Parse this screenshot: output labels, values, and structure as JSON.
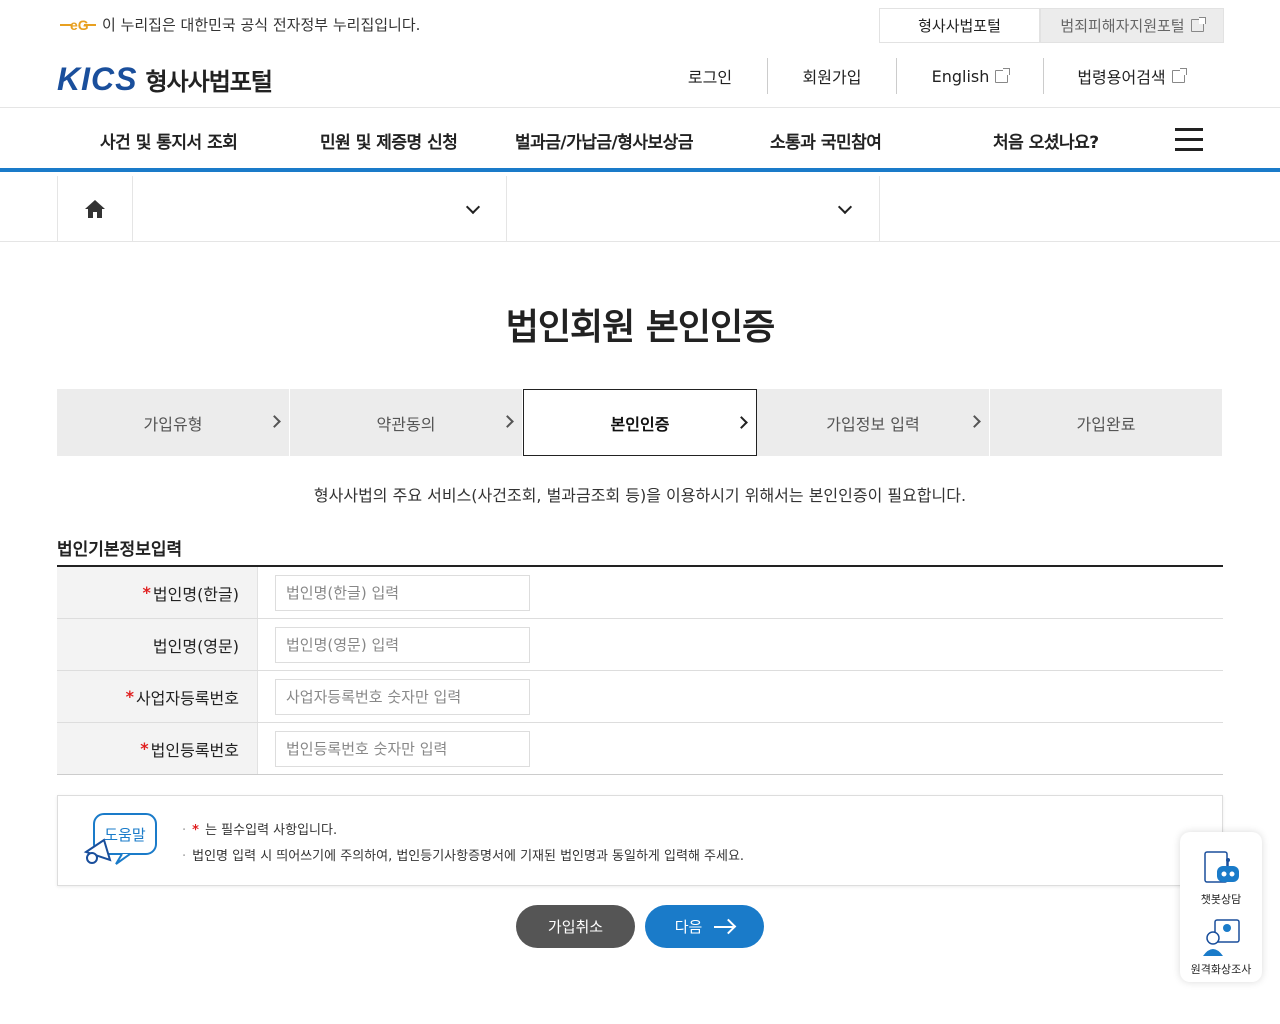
{
  "topbar": {
    "gov_notice": "이 누리집은 대한민국 공식 전자정부 누리집입니다.",
    "portals": [
      "형사사법포털",
      "범죄피해자지원포털"
    ]
  },
  "header": {
    "logo_brand": "KICS",
    "logo_name": "형사사법포털",
    "util": [
      "로그인",
      "회원가입",
      "English",
      "법령용어검색"
    ]
  },
  "gnb": [
    "사건 및 통지서 조회",
    "민원 및 제증명 신청",
    "벌과금/가납금/형사보상금",
    "소통과 국민참여",
    "처음 오셨나요?"
  ],
  "page": {
    "title": "법인회원 본인인증",
    "steps": [
      "가입유형",
      "약관동의",
      "본인인증",
      "가입정보 입력",
      "가입완료"
    ],
    "active_step": 2,
    "description": "형사사법의 주요 서비스(사건조회, 벌과금조회 등)을 이용하시기 위해서는 본인인증이 필요합니다.",
    "section_title": "법인기본정보입력",
    "fields": [
      {
        "label": "법인명(한글)",
        "required": true,
        "placeholder": "법인명(한글) 입력"
      },
      {
        "label": "법인명(영문)",
        "required": false,
        "placeholder": "법인명(영문) 입력"
      },
      {
        "label": "사업자등록번호",
        "required": true,
        "placeholder": "사업자등록번호 숫자만 입력"
      },
      {
        "label": "법인등록번호",
        "required": true,
        "placeholder": "법인등록번호 숫자만 입력"
      }
    ],
    "help": {
      "icon_label": "도움말",
      "lines": [
        "는 필수입력 사항입니다.",
        "법인명 입력 시 띄어쓰기에 주의하여, 법인등기사항증명서에 기재된 법인명과 동일하게 입력해 주세요."
      ],
      "required_mark": "*"
    },
    "buttons": {
      "cancel": "가입취소",
      "next": "다음"
    }
  },
  "floating": {
    "chatbot": "챗봇상담",
    "video": "원격화상조사"
  },
  "colors": {
    "accent": "#1a7bc9",
    "brand": "#1a4f9c",
    "required": "#e02020"
  }
}
